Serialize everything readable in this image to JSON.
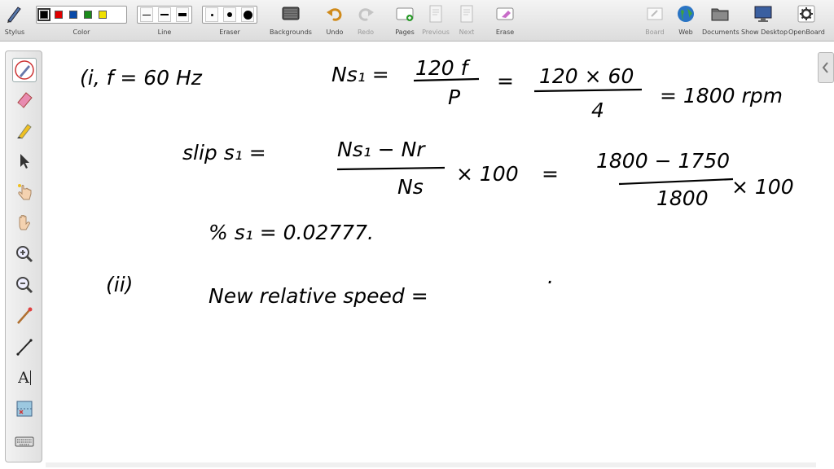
{
  "toolbar": {
    "stylus_label": "Stylus",
    "color_label": "Color",
    "line_label": "Line",
    "eraser_label": "Eraser",
    "backgrounds_label": "Backgrounds",
    "undo_label": "Undo",
    "redo_label": "Redo",
    "pages_label": "Pages",
    "previous_label": "Previous",
    "next_label": "Next",
    "erase_label": "Erase",
    "board_label": "Board",
    "web_label": "Web",
    "documents_label": "Documents",
    "show_desktop_label": "Show Desktop",
    "openboard_label": "OpenBoard",
    "colors": [
      "#000000",
      "#e00000",
      "#0a4aa8",
      "#1a8a1a",
      "#f0e000"
    ]
  },
  "sidebar": {
    "tools": [
      "pen-icon",
      "eraser-icon",
      "marker-icon",
      "pointer-icon",
      "laser-hand-icon",
      "hand-icon",
      "zoom-in-icon",
      "zoom-out-icon",
      "pointer-stick-icon",
      "line-icon",
      "text-icon",
      "capture-icon",
      "keyboard-icon"
    ],
    "text_tool_label": "A"
  },
  "board": {
    "line1_left": "(i,  f = 60 Hz",
    "line1_ns": "Ns₁  =",
    "frac1_num": "120 f",
    "frac1_den": "P",
    "eq1": "=",
    "frac2_num": "120 × 60",
    "frac2_den": "4",
    "line1_result": "= 1800 rpm",
    "line2_slip": "slip  s₁ =",
    "frac3_num": "Ns₁ − Nr",
    "frac3_den": "Ns",
    "times100a": "× 100",
    "eq2": "=",
    "frac4_num": "1800 − 1750",
    "frac4_den": "1800",
    "times100b": "× 100",
    "line3": "%  s₁  =  0.02777.",
    "line4_label": "(ii)",
    "line4_text": "New   relative   speed  =",
    "line4_dot": "."
  }
}
